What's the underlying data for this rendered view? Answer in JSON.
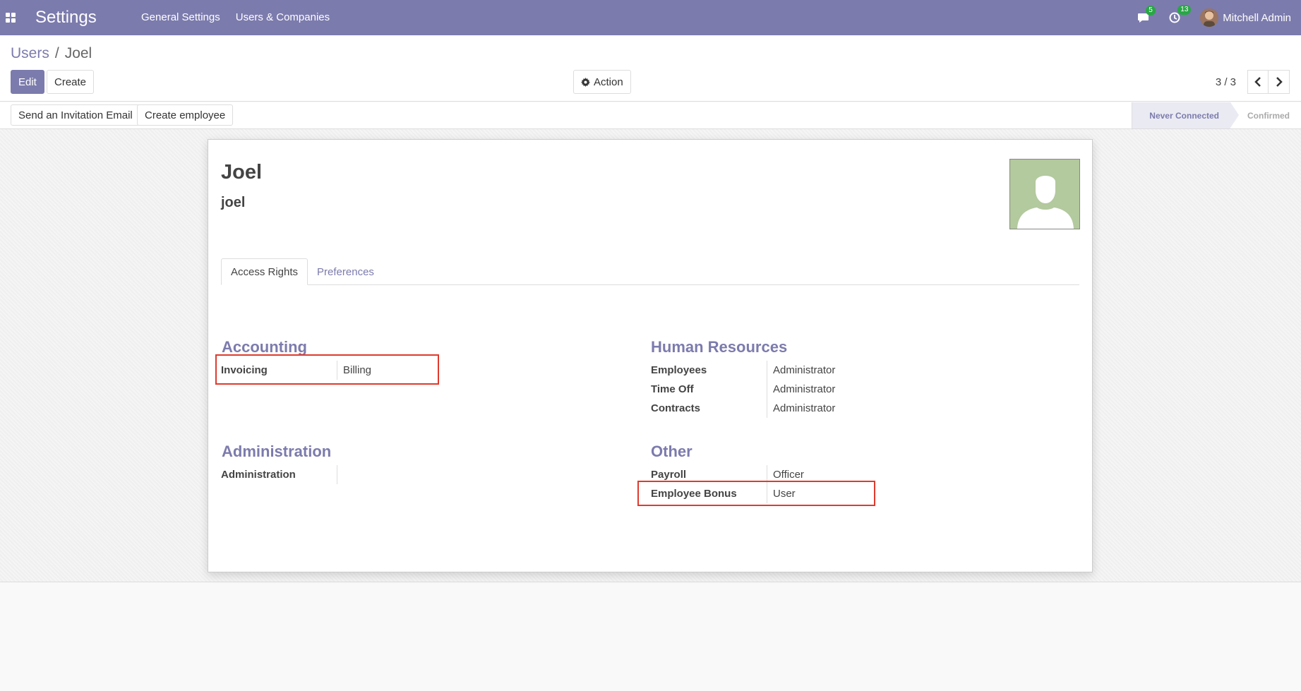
{
  "navbar": {
    "app_title": "Settings",
    "menu": [
      "General Settings",
      "Users & Companies"
    ],
    "messages_count": "5",
    "activities_count": "13",
    "user_name": "Mitchell Admin"
  },
  "control_panel": {
    "breadcrumb_parent": "Users",
    "breadcrumb_separator": "/",
    "breadcrumb_current": "Joel",
    "edit_label": "Edit",
    "create_label": "Create",
    "action_label": "Action",
    "pager_value": "3 / 3"
  },
  "statusbar": {
    "invite_label": "Send an Invitation Email",
    "create_employee_label": "Create employee",
    "stages": [
      "Never Connected",
      "Confirmed"
    ]
  },
  "form": {
    "name": "Joel",
    "login": "joel",
    "tabs": [
      "Access Rights",
      "Preferences"
    ],
    "groups": {
      "accounting": {
        "title": "Accounting",
        "fields": [
          {
            "label": "Invoicing",
            "value": "Billing"
          }
        ]
      },
      "human_resources": {
        "title": "Human Resources",
        "fields": [
          {
            "label": "Employees",
            "value": "Administrator"
          },
          {
            "label": "Time Off",
            "value": "Administrator"
          },
          {
            "label": "Contracts",
            "value": "Administrator"
          }
        ]
      },
      "administration": {
        "title": "Administration",
        "fields": [
          {
            "label": "Administration",
            "value": ""
          }
        ]
      },
      "other": {
        "title": "Other",
        "fields": [
          {
            "label": "Payroll",
            "value": "Officer"
          },
          {
            "label": "Employee Bonus",
            "value": "User"
          }
        ]
      }
    }
  },
  "colors": {
    "brand": "#7c7bad",
    "highlight": "#e03a2d",
    "badge": "#28a745"
  }
}
